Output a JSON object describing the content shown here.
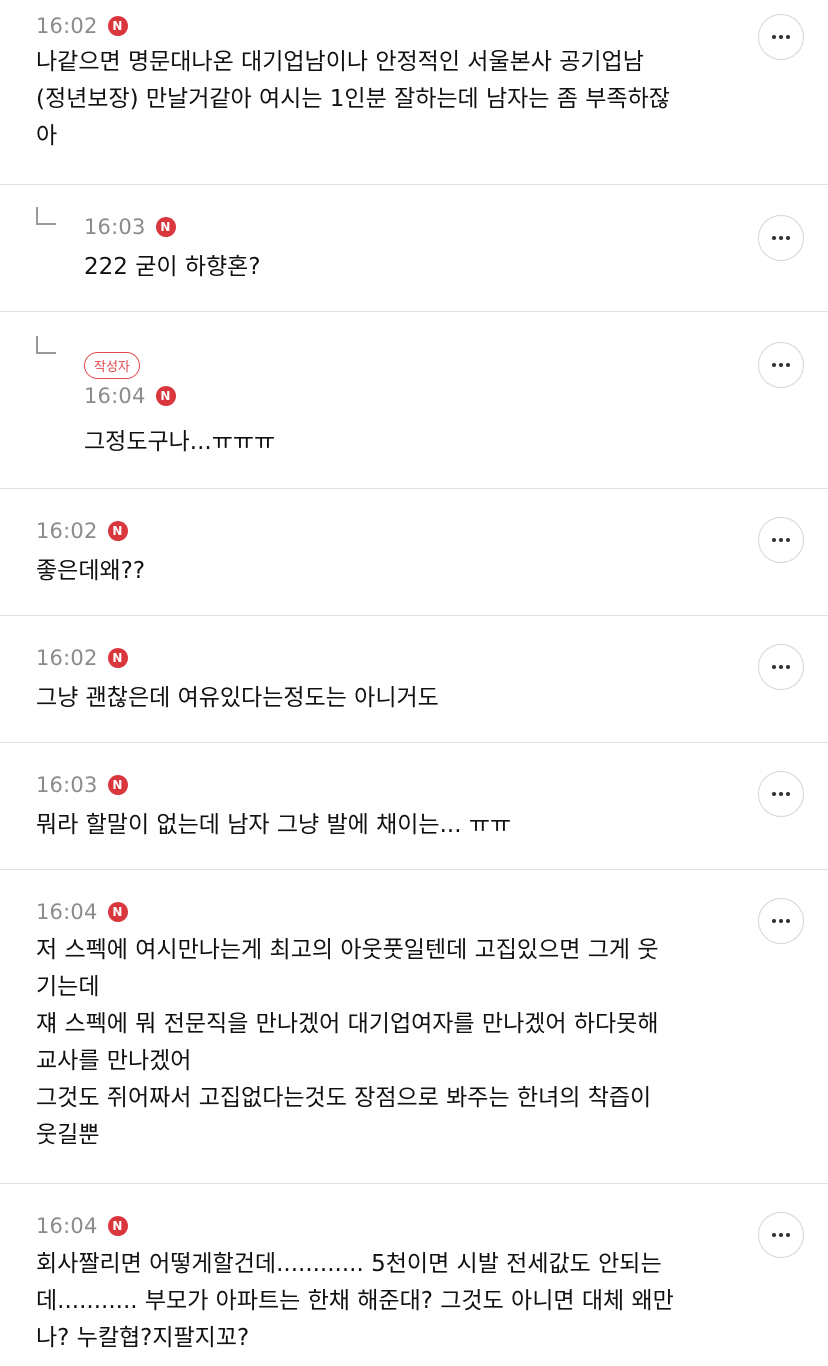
{
  "badge_letter": "N",
  "author_badge": "작성자",
  "more_label": "more",
  "comments": [
    {
      "time": "16:02",
      "text": "나같으면 명문대나온 대기업남이나 안정적인 서울본사 공기업남\n(정년보장) 만날거같아 여시는 1인분 잘하는데 남자는 좀 부족하잖\n아"
    },
    {
      "time": "16:03",
      "text": "222 굳이 하향혼?"
    },
    {
      "time": "16:04",
      "text": "그정도구나...ㅠㅠㅠ"
    },
    {
      "time": "16:02",
      "text": "좋은데왜??"
    },
    {
      "time": "16:02",
      "text": "그냥 괜찮은데 여유있다는정도는 아니거도"
    },
    {
      "time": "16:03",
      "text": "뭐라 할말이 없는데 남자 그냥 발에 채이는... ㅠㅠ"
    },
    {
      "time": "16:04",
      "text": "저 스펙에 여시만나는게 최고의 아웃풋일텐데 고집있으면 그게 웃\n기는데\n쟤 스펙에 뭐 전문직을 만나겠어 대기업여자를 만나겠어 하다못해\n교사를 만나겠어\n그것도 쥐어짜서 고집없다는것도 장점으로 봐주는 한녀의 착즙이\n웃길뿐"
    },
    {
      "time": "16:04",
      "text": "회사짤리면 어떻게할건데............ 5천이면 시발 전세값도 안되는\n데........... 부모가 아파트는 한채 해준대? 그것도 아니면 대체 왜만\n나? 누칼협?지팔지꼬?"
    }
  ]
}
